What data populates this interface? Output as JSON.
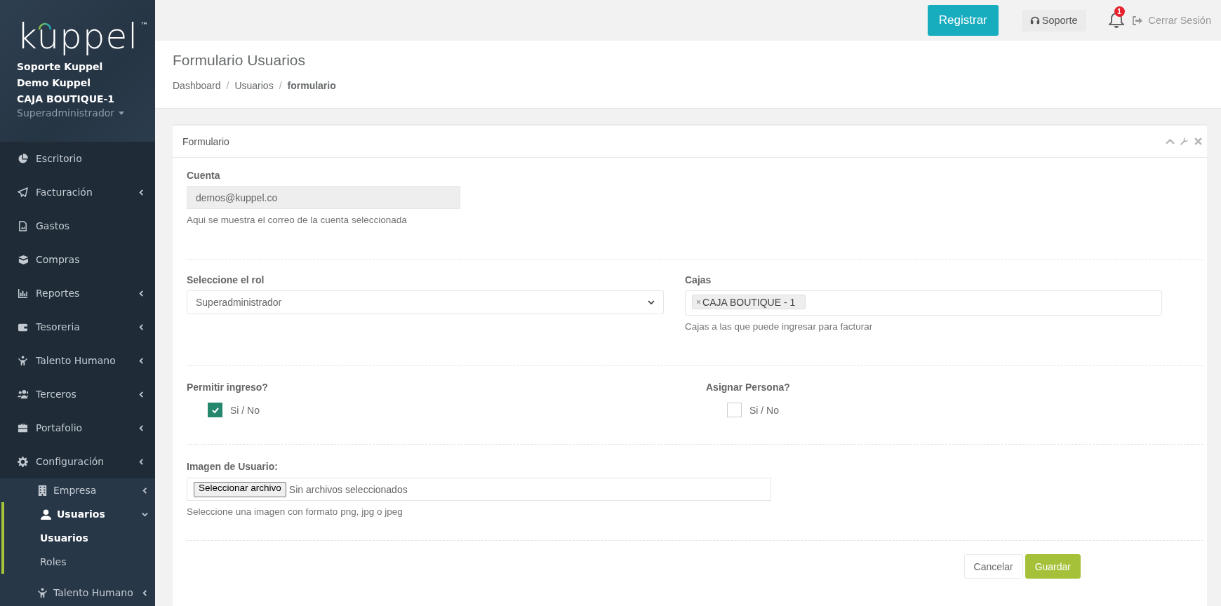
{
  "sidebar": {
    "logo": {
      "text": "kuppel",
      "mark": "™"
    },
    "user": [
      "Soporte Kuppel",
      "Demo Kuppel",
      "CAJA BOUTIQUE-1"
    ],
    "role": "Superadministrador",
    "menu": [
      {
        "label": "Escritorio",
        "has_submenu": false
      },
      {
        "label": "Facturación",
        "has_submenu": true,
        "expanded": false
      },
      {
        "label": "Gastos",
        "has_submenu": false
      },
      {
        "label": "Compras",
        "has_submenu": false
      },
      {
        "label": "Reportes",
        "has_submenu": true,
        "expanded": false
      },
      {
        "label": "Tesoreria",
        "has_submenu": true,
        "expanded": false
      },
      {
        "label": "Talento Humano",
        "has_submenu": true,
        "expanded": false
      },
      {
        "label": "Terceros",
        "has_submenu": true,
        "expanded": false
      },
      {
        "label": "Portafolio",
        "has_submenu": true,
        "expanded": false
      },
      {
        "label": "Configuración",
        "has_submenu": true,
        "expanded": true,
        "children": [
          {
            "label": "Empresa",
            "expanded": false
          },
          {
            "label": "Usuarios",
            "expanded": true,
            "children": [
              {
                "label": "Usuarios",
                "selected": true
              },
              {
                "label": "Roles",
                "selected": false
              }
            ]
          },
          {
            "label": "Talento Humano",
            "expanded": false
          }
        ]
      }
    ]
  },
  "topbar": {
    "register": "Registrar",
    "support": "Soporte",
    "notifications": "1",
    "logout": "Cerrar Sesión"
  },
  "header": {
    "title": "Formulario Usuarios",
    "separator": "/",
    "breadcrumb": [
      {
        "label": "Dashboard",
        "current": false
      },
      {
        "label": "Usuarios",
        "current": false
      },
      {
        "label": "formulario",
        "current": true
      }
    ]
  },
  "panel": {
    "title": "Formulario",
    "account": {
      "label": "Cuenta",
      "value": "demos@kuppel.co",
      "disabled": true,
      "help": "Aqui se muestra el correo de la cuenta seleccionada"
    },
    "role": {
      "label": "Seleccione el rol",
      "value": "Superadministrador"
    },
    "boxes": {
      "label": "Cajas",
      "tags": [
        {
          "label": "CAJA BOUTIQUE - 1",
          "remove": "×"
        }
      ],
      "help": "Cajas a las que puede ingresar para facturar"
    },
    "toggles": [
      {
        "label": "Permitir ingreso?",
        "option": "Si / No",
        "checked": true
      },
      {
        "label": "Asignar Persona?",
        "option": "Si / No",
        "checked": false
      }
    ],
    "image": {
      "label": "Imagen de Usuario:",
      "button": "Seleccionar archivo",
      "value": "Sin archivos seleccionados",
      "help": "Seleccione una imagen con formato png, jpg o jpeg"
    },
    "buttons": [
      {
        "label": "Cancelar",
        "kind": "secondary"
      },
      {
        "label": "Guardar",
        "kind": "primary"
      }
    ]
  }
}
